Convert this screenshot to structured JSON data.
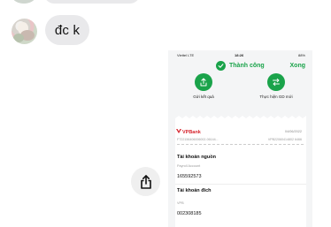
{
  "chat": {
    "message": "đc k"
  },
  "phone": {
    "status": {
      "carrier": "Viettel LTE",
      "time": "18:26",
      "battery": "88%"
    },
    "header": {
      "title": "Thành công",
      "done": "Xong"
    },
    "actions": [
      {
        "label": "Gửi kết quả",
        "icon": "upload-icon"
      },
      {
        "label": "Thực hiện GD mới",
        "icon": "swap-icon"
      }
    ],
    "receipt": {
      "bank": "VPBank",
      "date": "04/06/2022",
      "ref_left": "FT22156406006002-06144...",
      "ref_right": "VPB22060414802 6466",
      "source_title": "Tài khoản nguồn",
      "source_label": "Payroll Account",
      "source_value": "165592573",
      "dest_title": "Tài khoản đích",
      "dest_label": "VPB",
      "dest_value": "002308185"
    },
    "accent": "#1aa34a"
  }
}
